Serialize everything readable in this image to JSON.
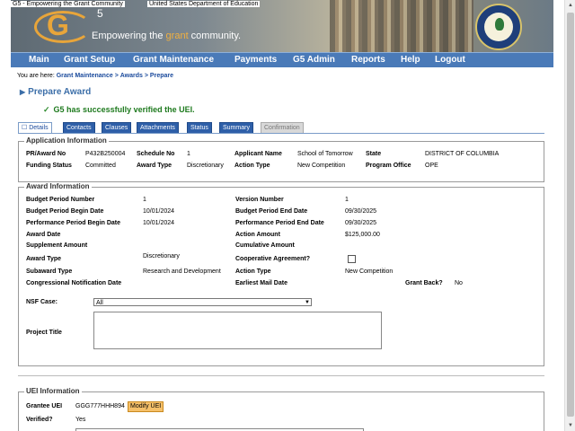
{
  "header": {
    "logo_alt": "G5 - Empowering the Grant Community",
    "gov_alt": "United States Department of Education",
    "logo_letter": "G",
    "logo_number": "5",
    "tagline_pre": "Empowering the ",
    "tagline_hl": "grant",
    "tagline_post": " community."
  },
  "nav": [
    "Main",
    "Grant Setup",
    "Grant Maintenance",
    "Payments",
    "G5 Admin",
    "Reports",
    "Help",
    "Logout"
  ],
  "breadcrumb": {
    "prefix": "You are here:",
    "items": [
      "Grant Maintenance",
      "Awards",
      "Prepare"
    ],
    "sep": ">"
  },
  "page_title": "Prepare Award",
  "success_msg": "G5 has successfully verified the UEI.",
  "tabs": [
    "Details",
    "Contacts",
    "Clauses",
    "Attachments",
    "Status",
    "Summary",
    "Confirmation"
  ],
  "app_info": {
    "legend": "Application Information",
    "pr_label": "PR/Award No",
    "pr_value": "P432B250004",
    "sched_label": "Schedule No",
    "sched_value": "1",
    "applicant_label": "Applicant Name",
    "applicant_value": "School of Tomorrow",
    "state_label": "State",
    "state_value": "DISTRICT OF COLUMBIA",
    "funding_label": "Funding Status",
    "funding_value": "Committed",
    "awardtype_label": "Award Type",
    "awardtype_value": "Discretionary",
    "action_label": "Action Type",
    "action_value": "New Competition",
    "office_label": "Program Office",
    "office_value": "OPE"
  },
  "award_info": {
    "legend": "Award Information",
    "bp_num_label": "Budget Period Number",
    "bp_num_value": "1",
    "version_label": "Version Number",
    "version_value": "1",
    "bp_begin_label": "Budget Period Begin Date",
    "bp_begin_value": "10/01/2024",
    "bp_end_label": "Budget Period End Date",
    "bp_end_value": "09/30/2025",
    "pp_begin_label": "Performance Period Begin Date",
    "pp_begin_value": "10/01/2024",
    "pp_end_label": "Performance Period End Date",
    "pp_end_value": "09/30/2025",
    "award_date_label": "Award Date",
    "action_amt_label": "Action Amount",
    "action_amt_value": "$125,000.00",
    "supp_label": "Supplement Amount",
    "cumul_label": "Cumulative Amount",
    "atype_label": "Award Type",
    "atype_value": "Discretionary",
    "coop_label": "Cooperative Agreement?",
    "subaward_label": "Subaward Type",
    "subaward_value": "Research and Development",
    "action2_label": "Action Type",
    "action2_value": "New Competition",
    "cong_label": "Congressional Notification Date",
    "mail_label": "Earliest Mail Date",
    "grantback_label": "Grant Back?",
    "grantback_value": "No",
    "nsf_label": "NSF Case:",
    "nsf_value": "All",
    "project_label": "Project Title"
  },
  "uei_info": {
    "legend": "UEI Information",
    "grantee_label": "Grantee UEI",
    "grantee_value": "GGG777HHH894",
    "modify_label": "Modify UEI",
    "verified_label": "Verified?",
    "verified_value": "Yes"
  },
  "colors": {
    "nav": "#4a7ab8",
    "title": "#3b6ea8",
    "success": "#1e7a1e",
    "accent": "#e8a53a"
  }
}
